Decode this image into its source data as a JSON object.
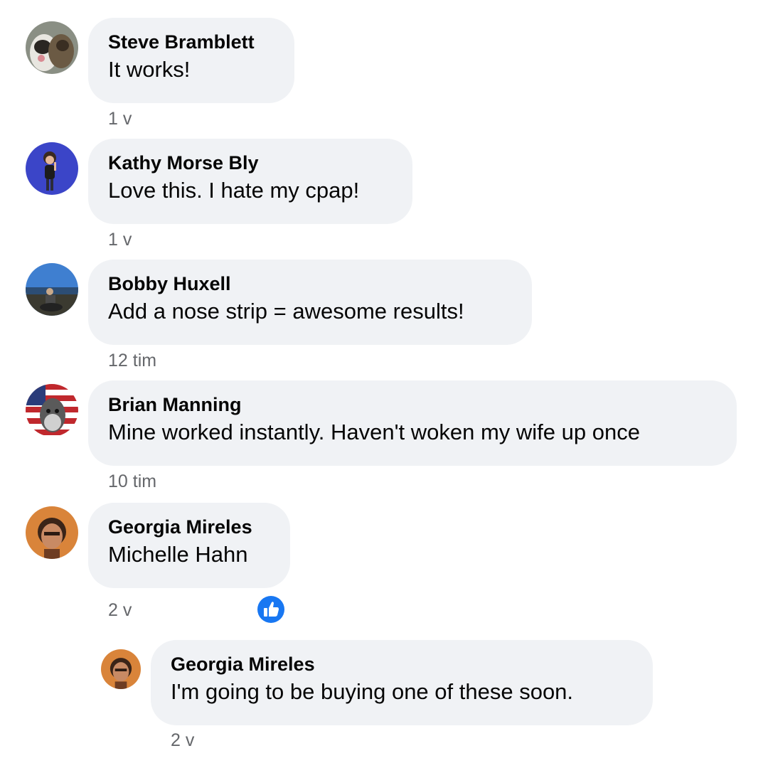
{
  "comments": [
    {
      "author": "Steve Bramblett",
      "text": "It works!",
      "time": "1 v",
      "avatar_icon": "dogs-avatar-icon"
    },
    {
      "author": "Kathy Morse Bly",
      "text": "Love this. I hate my cpap!",
      "time": "1 v",
      "avatar_icon": "bitmoji-avatar-icon"
    },
    {
      "author": "Bobby Huxell",
      "text": "Add a nose strip = awesome results!",
      "time": "12 tim",
      "avatar_icon": "landscape-avatar-icon"
    },
    {
      "author": "Brian Manning",
      "text": "Mine worked instantly. Haven't woken my wife up once",
      "time": "10 tim",
      "avatar_icon": "schnauzer-flag-avatar-icon"
    },
    {
      "author": "Georgia Mireles",
      "text": "Michelle Hahn",
      "time": "2 v",
      "avatar_icon": "portrait-avatar-icon",
      "reaction": "like-icon"
    }
  ],
  "reply": {
    "author": "Georgia Mireles",
    "text": "I'm going to be buying one of these soon.",
    "time": "2 v",
    "avatar_icon": "portrait-avatar-icon"
  },
  "colors": {
    "bubble": "#f0f2f5",
    "meta": "#65676b",
    "like": "#1877f2"
  }
}
